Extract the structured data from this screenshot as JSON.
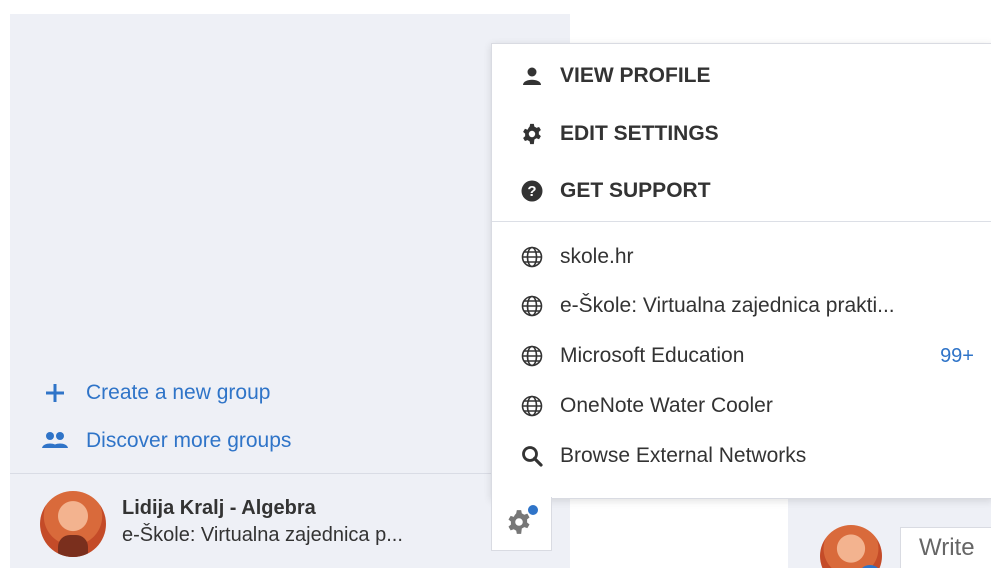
{
  "left": {
    "create_group_label": "Create a new group",
    "discover_groups_label": "Discover more groups",
    "account": {
      "name": "Lidija Kralj - Algebra",
      "network": "e-Škole: Virtualna zajednica p..."
    }
  },
  "menu": {
    "view_profile": "VIEW PROFILE",
    "edit_settings": "EDIT SETTINGS",
    "get_support": "GET SUPPORT",
    "networks": [
      {
        "label": "skole.hr",
        "badge": ""
      },
      {
        "label": "e-Škole: Virtualna zajednica prakti...",
        "badge": ""
      },
      {
        "label": "Microsoft Education",
        "badge": "99+"
      },
      {
        "label": "OneNote Water Cooler",
        "badge": ""
      }
    ],
    "browse_external": "Browse External Networks"
  },
  "compose": {
    "placeholder": "Write"
  },
  "colors": {
    "accent": "#2f74c8",
    "panel_bg": "#eef0f6"
  },
  "icons": {
    "view_profile": "person-icon",
    "edit_settings": "gear-icon",
    "get_support": "help-icon",
    "network": "globe-icon",
    "browse": "search-icon",
    "create_group": "plus-icon",
    "discover_groups": "people-icon"
  }
}
